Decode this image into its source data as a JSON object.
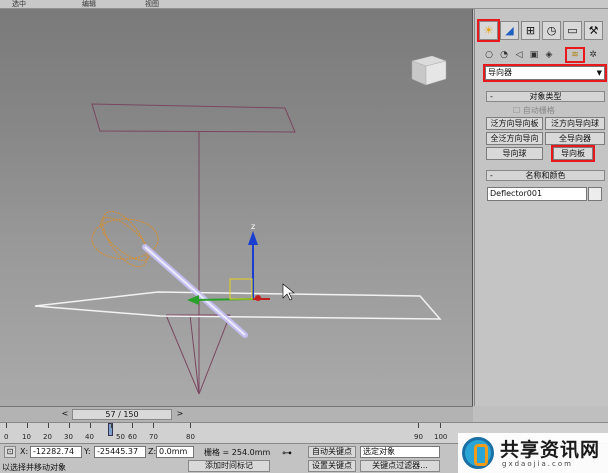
{
  "top_strip": [
    "选中",
    "编辑",
    "视图"
  ],
  "viewport": {
    "cube_label": ""
  },
  "panel": {
    "tabs": [
      "create-icon",
      "modify-icon",
      "hierarchy-icon",
      "motion-icon",
      "display-icon",
      "utilities-icon"
    ],
    "sub_icons": [
      "geometry-icon",
      "shapes-icon",
      "lights-icon",
      "cameras-icon",
      "helpers-icon",
      "space-warps-icon",
      "systems-icon"
    ],
    "category_dropdown": "导向器",
    "object_type": {
      "header": "对象类型",
      "autogrid": "自动栅格",
      "buttons": [
        "泛方向导向板",
        "泛方向导向球",
        "全泛方向导向",
        "全导向器",
        "导向球",
        "导向板"
      ]
    },
    "name_color": {
      "header": "名称和颜色",
      "name_value": "Deflector001"
    }
  },
  "timeline": {
    "position": "57 / 150",
    "prev": "<",
    "next": ">"
  },
  "ruler": {
    "ticks": [
      "0",
      "10",
      "20",
      "30",
      "40",
      "50",
      "60",
      "70",
      "80",
      "90",
      "100"
    ],
    "current_frame": 57
  },
  "status": {
    "x_label": "X:",
    "x_value": "-12282.74",
    "y_label": "Y:",
    "y_value": "-25445.37",
    "z_label": "Z:",
    "z_value": "0.0mm",
    "grid": "栅格 = 254.0mm",
    "auto_key": "自动关键点",
    "set_key": "设置关键点",
    "selected_dropdown": "选定对象",
    "key_filters": "关键点过滤器...",
    "add_time_tag": "添加时间标记",
    "prompt": "以选择并移动对象"
  },
  "watermark": {
    "title": "共享资讯网",
    "url": "gxdaojia.com"
  }
}
